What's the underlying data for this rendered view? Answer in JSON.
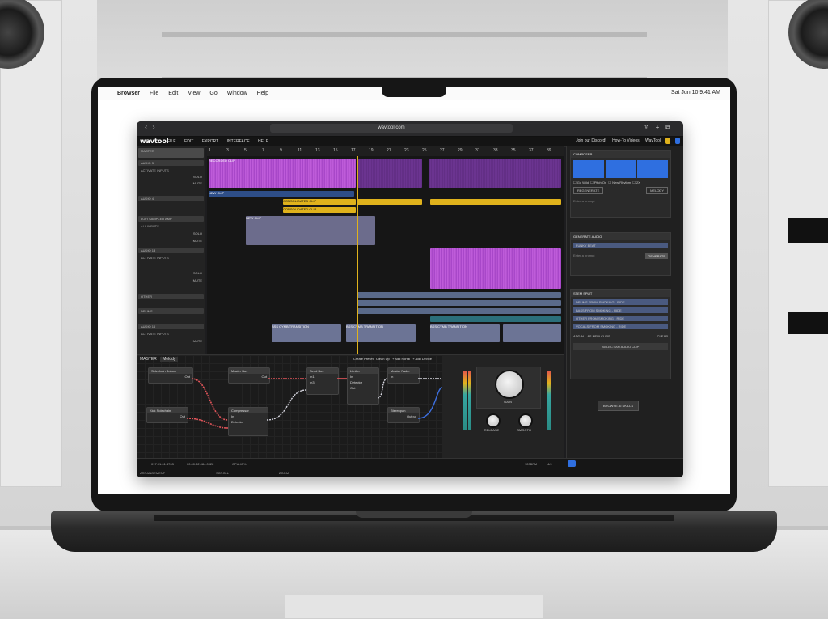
{
  "menubar": {
    "app": "Browser",
    "items": [
      "File",
      "Edit",
      "View",
      "Go",
      "Window",
      "Help"
    ],
    "clock": "Sat Jun 10  9:41 AM"
  },
  "browser": {
    "url": "wavtool.com"
  },
  "app": {
    "logo": "wavtool",
    "menu": [
      "FILE",
      "EDIT",
      "EXPORT",
      "INTERFACE",
      "HELP"
    ],
    "header_right": [
      "Join our Discord!",
      "How-To Videos",
      "WavTool"
    ]
  },
  "ruler": [
    "1",
    "3",
    "5",
    "7",
    "9",
    "11",
    "13",
    "15",
    "17",
    "19",
    "21",
    "23",
    "25",
    "27",
    "29",
    "31",
    "33",
    "35",
    "37",
    "39"
  ],
  "tracks": [
    {
      "name": "MASTER"
    },
    {
      "name": "AUDIO 3"
    },
    {
      "name": "AUDIO 4"
    },
    {
      "name": "LOFI SAMPLER AMP"
    },
    {
      "name": "AUDIO 13"
    },
    {
      "name": "OTHER"
    },
    {
      "name": "DRUMS"
    },
    {
      "name": "AUDIO 16"
    }
  ],
  "track_controls": {
    "activate_inputs": "ACTIVATE INPUTS",
    "all_inputs": "ALL INPUTS",
    "off": "OFF",
    "solo": "SOLO",
    "mute": "MUTE",
    "auto": "AUTO"
  },
  "clips": {
    "recorded": "RECORDED CLIP",
    "new": "NEW CLIP",
    "consolidated": "CONSOLIDATED CLIP",
    "transition": "BSS CYMB TRANSITION"
  },
  "device_panel": {
    "master_label": "MASTER",
    "preset": "Melody",
    "actions": [
      "Create Preset",
      "Clean Up",
      "+ Add Portal",
      "+ Add Device"
    ],
    "nodes": {
      "sidechain_subsrc": "Sidechain Subsrc",
      "kick_sidechain": "Kick Sidechain",
      "master_bus": "Master Bus",
      "compressor": "Compressor",
      "send_bus": "Send Bus",
      "limiter": "Limiter",
      "master_fader": "Master Fader",
      "stereo": "Stereopan"
    },
    "ports": {
      "out": "Out",
      "in": "In",
      "in1": "In1",
      "in2": "In2",
      "in3": "In3",
      "detector": "Detector",
      "output": "Output"
    }
  },
  "mixer": {
    "gain": "GAIN",
    "release": "RELEASE",
    "smooth": "SMOOTH"
  },
  "composer": {
    "title": "COMPOSER",
    "options": [
      "Go Wild",
      "Pitch On",
      "New Rhythm",
      "2X"
    ],
    "regenerate": "REGENERATE",
    "melody": "MELODY",
    "prompt_placeholder": "Enter a prompt"
  },
  "generate_audio": {
    "title": "GENERATE AUDIO",
    "clip": "FUNKY BEAT",
    "prompt_placeholder": "Enter a prompt",
    "button": "GENERATE"
  },
  "stem_split": {
    "title": "STEM SPLIT",
    "stems": [
      "DRUMS FROM SMOKING - RIDE",
      "BASS FROM SMOKING - RIDE",
      "OTHER FROM SMOKING - RIDE",
      "VOCALS FROM SMOKING - RIDE"
    ],
    "add_all": "ADD ALL AS NEW CLIPS",
    "clear": "CLEAR",
    "select": "SELECT AN AUDIO CLIP"
  },
  "browse_button": "BROWSE AI SKILLS",
  "status": {
    "position": "017.01.01.4763",
    "time": "00:00:32.084.0022",
    "cpu": "CPU 43%",
    "arrangement": "ARRANGEMENT",
    "scroll": "SCROLL",
    "zoom": "ZOOM",
    "tempo": "120BPM",
    "ts": "4/4"
  }
}
